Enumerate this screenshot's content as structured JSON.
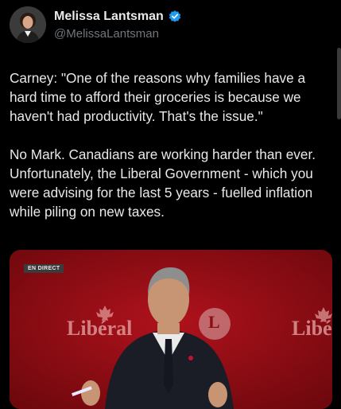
{
  "author": {
    "display_name": "Melissa Lantsman",
    "handle": "@MelissaLantsman",
    "verified": true,
    "avatar_icon": "profile-photo"
  },
  "tweet": {
    "paragraph_1": "Carney: \"One of the reasons why families have a hard time to afford their groceries is because we haven't had productivity. That's the issue.\"",
    "paragraph_2": "No Mark. Canadians are working harder than ever. Unfortunately, the Liberal Government - which you were advising for the last 5 years - fuelled inflation while piling on new taxes."
  },
  "media": {
    "live_badge": "EN DIRECT",
    "backdrop_text_left": "Libéral",
    "backdrop_text_right": "Libé",
    "logo_letter": "L",
    "colors": {
      "backdrop": "#8b0c12",
      "accent": "#c8102e"
    }
  },
  "colors": {
    "background": "#000000",
    "text": "#e7e9ea",
    "muted": "#71767b",
    "verified": "#1d9bf0"
  }
}
